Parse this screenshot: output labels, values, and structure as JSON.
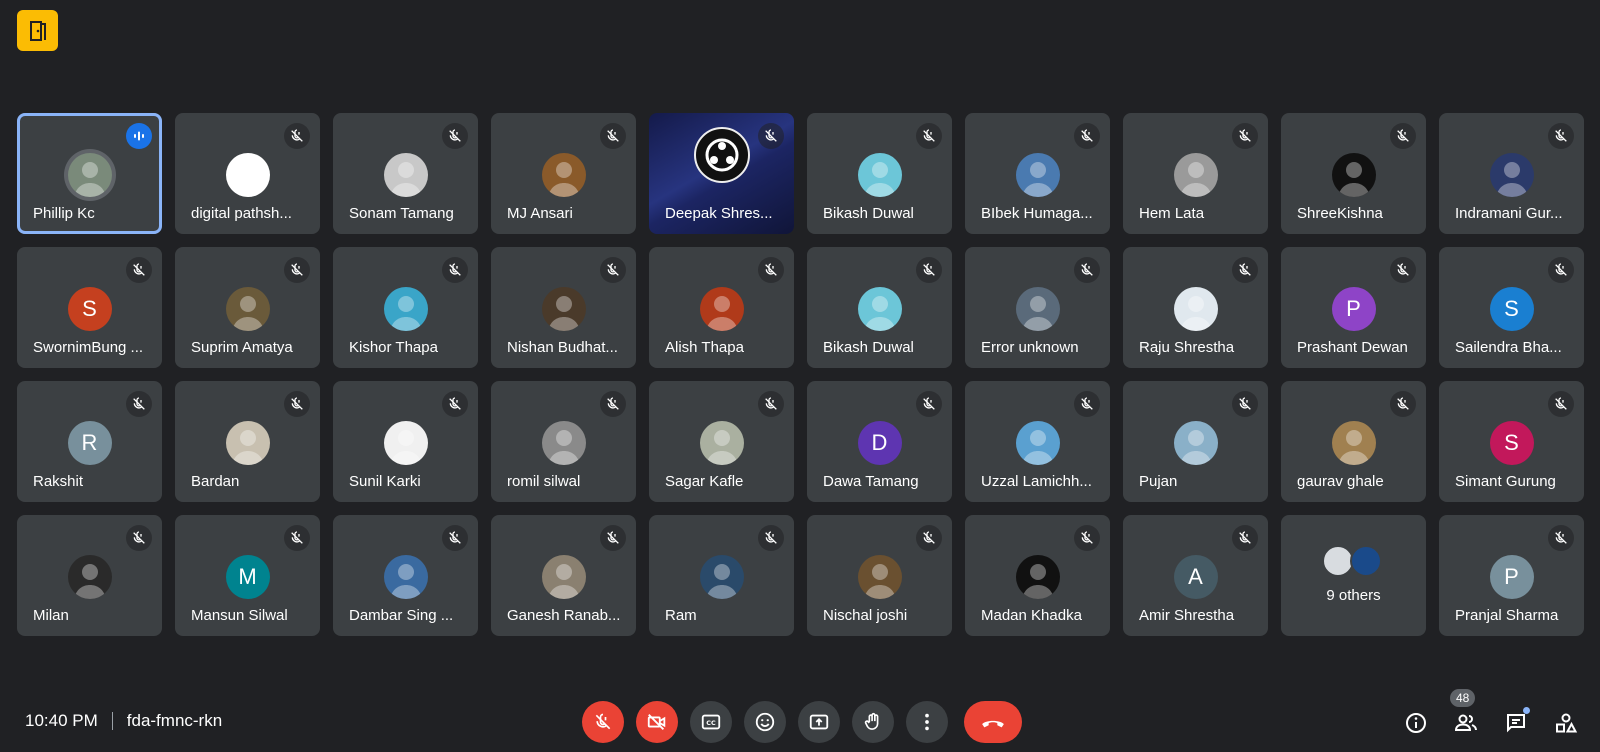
{
  "meeting": {
    "time": "10:40 PM",
    "code": "fda-fmnc-rkn",
    "participant_count": "48"
  },
  "participants": [
    {
      "name": "Phillip Kc",
      "color": "#7a8a7a",
      "initial": "",
      "speaking": true
    },
    {
      "name": "digital pathsh...",
      "color": "#ffffff",
      "initial": ""
    },
    {
      "name": "Sonam Tamang",
      "color": "#c8c8c8",
      "initial": ""
    },
    {
      "name": "MJ Ansari",
      "color": "#8a5a2a",
      "initial": ""
    },
    {
      "name": "Deepak Shres...",
      "color": "#111111",
      "initial": "",
      "presenting": true
    },
    {
      "name": "Bikash Duwal",
      "color": "#6cc6d8",
      "initial": ""
    },
    {
      "name": "BIbek Humaga...",
      "color": "#4a7ab0",
      "initial": ""
    },
    {
      "name": "Hem Lata",
      "color": "#9a9a9a",
      "initial": ""
    },
    {
      "name": "ShreeKishna",
      "color": "#111111",
      "initial": ""
    },
    {
      "name": "Indramani Gur...",
      "color": "#2b3a6a",
      "initial": ""
    },
    {
      "name": "SwornimBung ...",
      "color": "#c5401f",
      "initial": "S"
    },
    {
      "name": "Suprim Amatya",
      "color": "#6a5a3a",
      "initial": ""
    },
    {
      "name": "Kishor Thapa",
      "color": "#3aa5c8",
      "initial": ""
    },
    {
      "name": "Nishan Budhat...",
      "color": "#4a3a2a",
      "initial": ""
    },
    {
      "name": "Alish Thapa",
      "color": "#b03a1a",
      "initial": ""
    },
    {
      "name": "Bikash Duwal",
      "color": "#6cc6d8",
      "initial": ""
    },
    {
      "name": "Error unknown",
      "color": "#5a6a7a",
      "initial": ""
    },
    {
      "name": "Raju Shrestha",
      "color": "#e0e8ee",
      "initial": ""
    },
    {
      "name": "Prashant Dewan",
      "color": "#8e44c7",
      "initial": "P"
    },
    {
      "name": "Sailendra Bha...",
      "color": "#1a7fd1",
      "initial": "S"
    },
    {
      "name": "Rakshit",
      "color": "#78909c",
      "initial": "R"
    },
    {
      "name": "Bardan",
      "color": "#c8c0b0",
      "initial": ""
    },
    {
      "name": "Sunil Karki",
      "color": "#f0f0f0",
      "initial": ""
    },
    {
      "name": "romil silwal",
      "color": "#8a8a8a",
      "initial": ""
    },
    {
      "name": "Sagar Kafle",
      "color": "#aab0a0",
      "initial": ""
    },
    {
      "name": "Dawa Tamang",
      "color": "#5e35b1",
      "initial": "D"
    },
    {
      "name": "Uzzal Lamichh...",
      "color": "#5aa0d0",
      "initial": ""
    },
    {
      "name": "Pujan",
      "color": "#8ab0c8",
      "initial": ""
    },
    {
      "name": "gaurav ghale",
      "color": "#a08050",
      "initial": ""
    },
    {
      "name": "Simant Gurung",
      "color": "#c2185b",
      "initial": "S"
    },
    {
      "name": "Milan",
      "color": "#2a2a2a",
      "initial": ""
    },
    {
      "name": "Mansun Silwal",
      "color": "#00838f",
      "initial": "M"
    },
    {
      "name": "Dambar Sing ...",
      "color": "#3a6aa0",
      "initial": ""
    },
    {
      "name": "Ganesh Ranab...",
      "color": "#8a8070",
      "initial": ""
    },
    {
      "name": "Ram",
      "color": "#2a4a6a",
      "initial": ""
    },
    {
      "name": "Nischal joshi",
      "color": "#6a5030",
      "initial": ""
    },
    {
      "name": "Madan Khadka",
      "color": "#111111",
      "initial": ""
    },
    {
      "name": "Amir Shrestha",
      "color": "#455a64",
      "initial": "A"
    },
    {
      "name": "9 others",
      "others": true
    },
    {
      "name": "Pranjal Sharma",
      "color": "#78909c",
      "initial": "P"
    }
  ]
}
